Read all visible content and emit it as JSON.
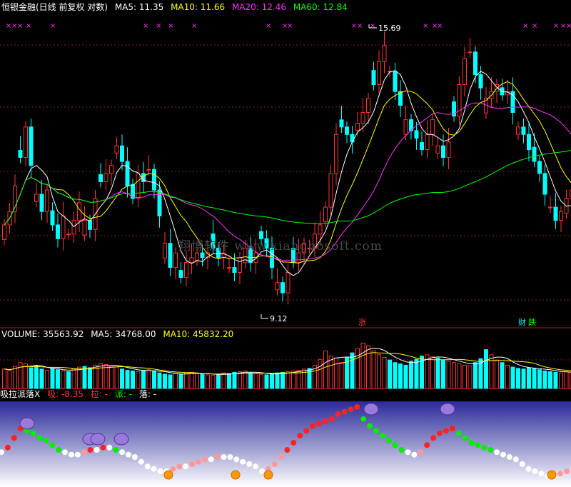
{
  "header": {
    "title": "恒银金融(日线 前复权 对数)",
    "ma5": "MA5: 11.35",
    "ma10": "MA10: 11.66",
    "ma20": "MA20: 12.46",
    "ma60": "MA60: 12.84"
  },
  "price_chart": {
    "high_label": "15.69",
    "low_label": "9.12",
    "mark_zhang": "涨",
    "mark_cai": "财",
    "mark_die": "跌"
  },
  "volume": {
    "label": "VOLUME: 35563.92",
    "ma5": "MA5: 34768.00",
    "ma10": "MA10: 45832.20"
  },
  "indicator": {
    "name": "吸拉派落X",
    "xi": "吸: -8.35",
    "la": "拉: -",
    "pai": "派: -",
    "luo": "落: -"
  },
  "watermark": "翔博软件 www.xiangbosoft.com",
  "colors": {
    "up": "#ff3333",
    "down": "#00ffff",
    "ma5": "#ffffff",
    "ma10": "#ffff00",
    "ma20": "#ff33ff",
    "ma60": "#00ff00",
    "indicator_bg_top": "#2a2a9a",
    "indicator_bg_bottom": "#ffffff"
  },
  "chart_data": {
    "type": "candlestick",
    "closes": [
      10.6,
      10.9,
      11.5,
      12.2,
      13.0,
      12.0,
      11.3,
      10.9,
      11.4,
      10.6,
      10.3,
      10.8,
      10.4,
      10.7,
      11.1,
      10.7,
      10.5,
      11.2,
      11.6,
      11.8,
      12.0,
      12.5,
      12.1,
      11.5,
      11.2,
      11.8,
      11.6,
      11.9,
      11.4,
      10.8,
      10.2,
      9.7,
      10.0,
      9.5,
      9.8,
      9.9,
      10.0,
      9.9,
      10.0,
      10.1,
      9.9,
      10.0,
      9.7,
      9.6,
      9.9,
      10.1,
      9.8,
      10.0,
      10.3,
      10.1,
      9.7,
      9.4,
      9.2,
      9.6,
      9.8,
      10.0,
      10.2,
      10.1,
      10.4,
      10.6,
      11.0,
      11.8,
      12.8,
      13.0,
      12.8,
      12.6,
      13.1,
      13.4,
      13.8,
      14.2,
      14.9,
      15.4,
      14.6,
      14.0,
      13.6,
      13.2,
      12.9,
      12.7,
      12.4,
      12.8,
      13.2,
      12.5,
      12.2,
      12.6,
      13.3,
      14.2,
      15.0,
      15.2,
      14.5,
      14.1,
      13.8,
      14.0,
      14.2,
      13.9,
      14.0,
      13.4,
      13.0,
      12.8,
      12.4,
      12.1,
      11.8,
      11.3,
      11.0,
      10.7,
      10.9,
      11.2,
      11.4
    ],
    "high": 15.69,
    "low": 9.12,
    "volume": [
      30,
      28,
      34,
      40,
      38,
      32,
      35,
      30,
      28,
      31,
      29,
      27,
      26,
      30,
      33,
      34,
      32,
      36,
      38,
      37,
      34,
      33,
      30,
      28,
      27,
      26,
      28,
      29,
      27,
      24,
      22,
      21,
      23,
      22,
      24,
      25,
      23,
      22,
      21,
      20,
      22,
      24,
      23,
      25,
      26,
      27,
      24,
      23,
      22,
      21,
      22,
      24,
      25,
      26,
      27,
      28,
      30,
      31,
      36,
      45,
      58,
      50,
      47,
      40,
      48,
      55,
      62,
      70,
      66,
      58,
      52,
      48,
      44,
      40,
      38,
      36,
      42,
      45,
      50,
      52,
      49,
      47,
      44,
      42,
      40,
      38,
      36,
      35,
      40,
      46,
      60,
      52,
      44,
      40,
      36,
      33,
      31,
      30,
      32,
      31,
      29,
      27,
      26,
      25,
      24,
      26,
      25
    ],
    "indicator": [
      -12,
      -10,
      -6,
      -2,
      -3,
      -4,
      -6,
      -7,
      -9,
      -11,
      -12,
      -13,
      -13,
      -12,
      -11,
      -11,
      -10,
      -10,
      -11,
      -12,
      -13,
      -14,
      -16,
      -18,
      -19,
      -20,
      -20,
      -19,
      -18,
      -18,
      -17,
      -16,
      -15,
      -15,
      -14,
      -14,
      -14,
      -15,
      -16,
      -17,
      -18,
      -20,
      -19,
      -17,
      -14,
      -11,
      -8,
      -5,
      -3,
      -1,
      0,
      1,
      2,
      4,
      5,
      6,
      7,
      2,
      -1,
      -3,
      -5,
      -7,
      -9,
      -11,
      -12,
      -13,
      -12,
      -9,
      -6,
      -4,
      -3,
      -2,
      -4,
      -6,
      -8,
      -9,
      -10,
      -11,
      -12,
      -13,
      -14,
      -15,
      -17,
      -19,
      -20,
      -21,
      -22,
      -22,
      -21,
      -20
    ]
  }
}
